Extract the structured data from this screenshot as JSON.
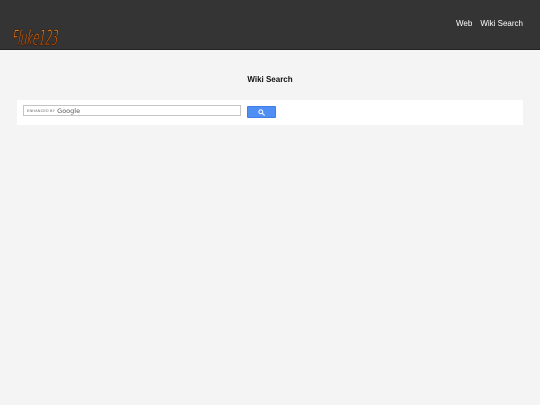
{
  "header": {
    "logo_text": "Fluke123",
    "nav": [
      {
        "label": "Web"
      },
      {
        "label": "Wiki Search"
      }
    ]
  },
  "main": {
    "title": "Wiki Search",
    "search": {
      "enhanced_label": "enhanced by",
      "brand": "Google",
      "value": "",
      "button_icon": "search-icon"
    }
  },
  "colors": {
    "header_bg": "#343434",
    "page_bg": "#f4f4f4",
    "button_bg": "#4f8ef5",
    "logo_fill": "#e8731c"
  }
}
